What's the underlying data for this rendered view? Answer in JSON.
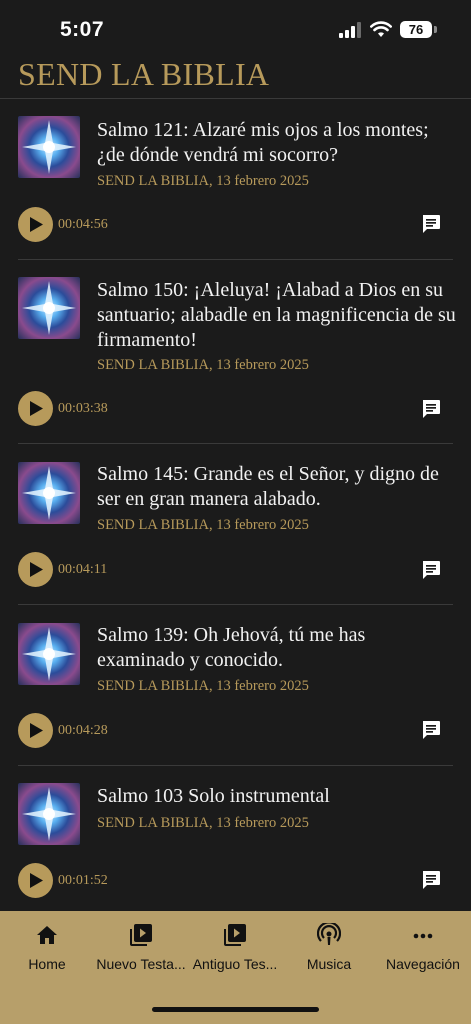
{
  "status_bar": {
    "time": "5:07",
    "battery": "76"
  },
  "app": {
    "title": "SEND LA BIBLIA"
  },
  "episodes": [
    {
      "title": "Salmo 121: Alzaré mis ojos a los montes; ¿de dónde vendrá mi socorro?",
      "meta": "SEND LA BIBLIA, 13 febrero 2025",
      "duration": "00:04:56"
    },
    {
      "title": "Salmo 150: ¡Aleluya! ¡Alabad a Dios en su santuario; alabadle en la magnificencia de su firmamento!",
      "meta": "SEND LA BIBLIA, 13 febrero 2025",
      "duration": "00:03:38"
    },
    {
      "title": "Salmo 145: Grande es el Señor, y digno de ser en gran manera alabado.",
      "meta": "SEND LA BIBLIA, 13 febrero 2025",
      "duration": "00:04:11"
    },
    {
      "title": "Salmo 139: Oh Jehová, tú me has examinado y conocido.",
      "meta": "SEND LA BIBLIA, 13 febrero 2025",
      "duration": "00:04:28"
    },
    {
      "title": "Salmo 103 Solo instrumental",
      "meta": "SEND LA BIBLIA, 13 febrero 2025",
      "duration": "00:01:52"
    }
  ],
  "tabs": [
    {
      "label": "Home",
      "icon": "home-icon"
    },
    {
      "label": "Nuevo Testa...",
      "icon": "video-library-icon"
    },
    {
      "label": "Antiguo Tes...",
      "icon": "video-library-icon"
    },
    {
      "label": "Musica",
      "icon": "podcast-icon"
    },
    {
      "label": "Navegación",
      "icon": "more-icon"
    }
  ],
  "colors": {
    "accent": "#b79a5b",
    "background": "#1b1b1b",
    "tab_bar": "#b79f6a"
  }
}
